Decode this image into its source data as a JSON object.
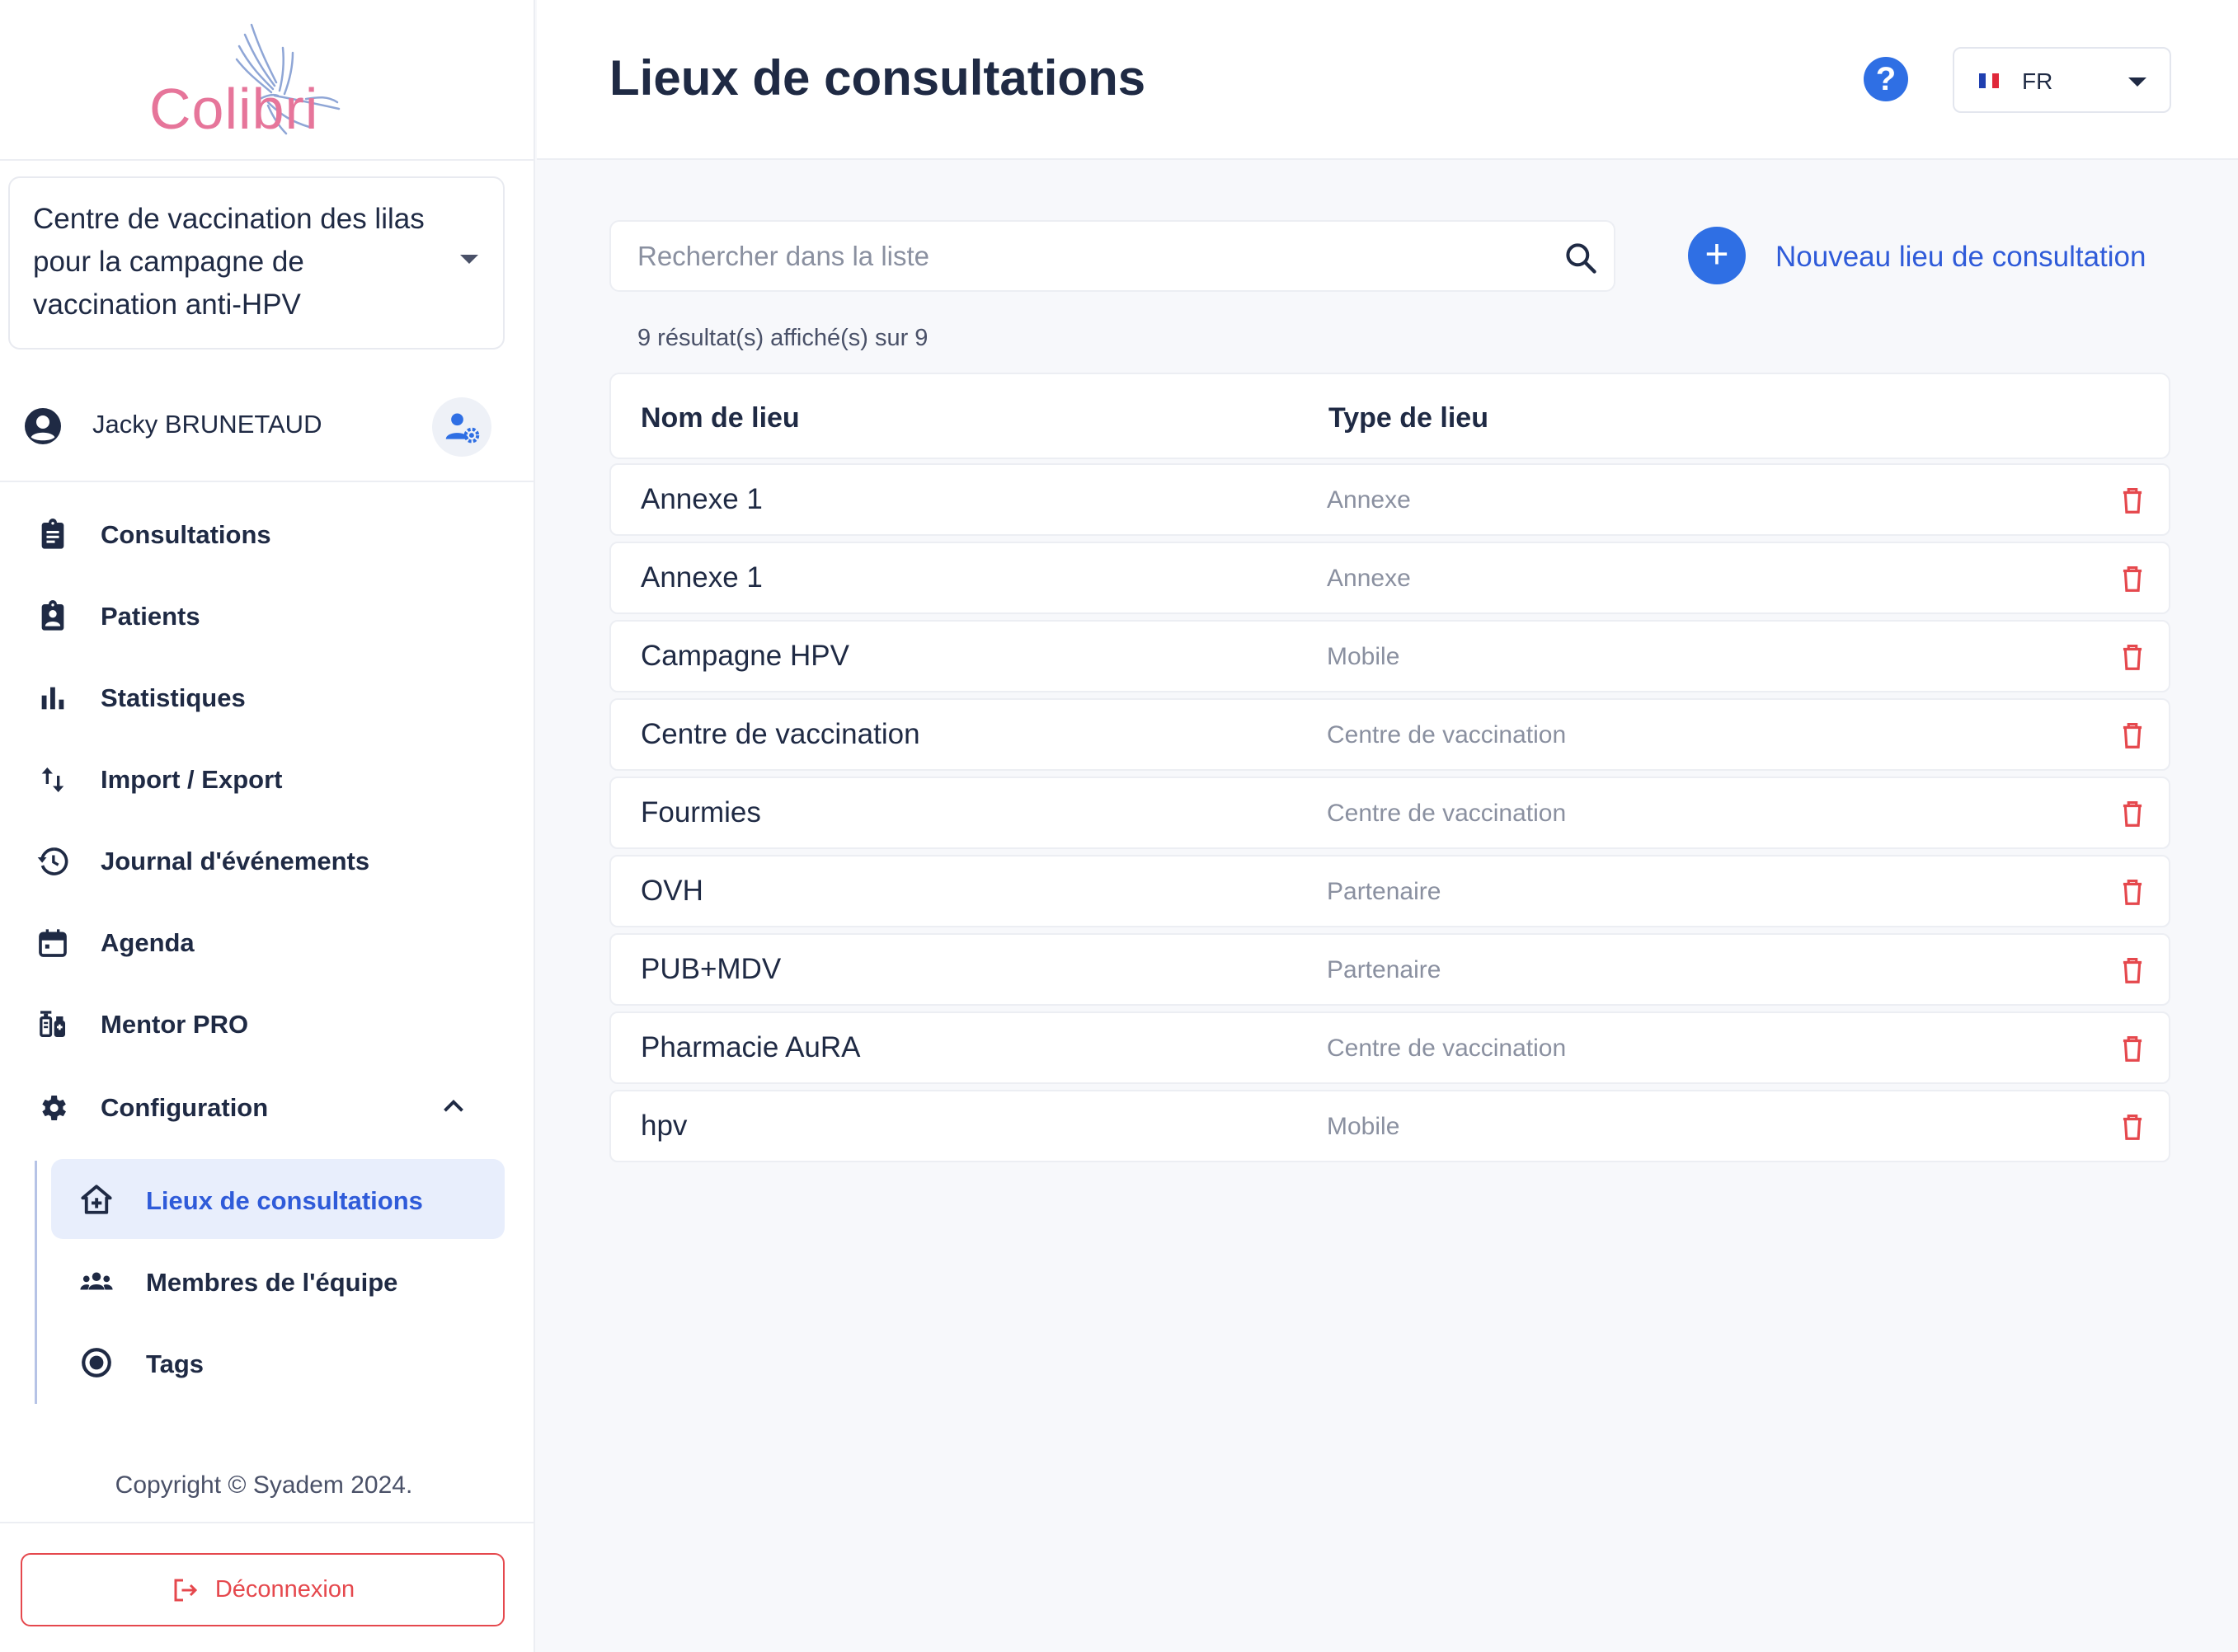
{
  "app": {
    "logo_text": "Colibri",
    "brand_color": "#e6759a",
    "accent_color": "#2f6fe4"
  },
  "sidebar": {
    "org_selector": {
      "value": "Centre de vaccination des lilas pour la campagne de vaccination anti-HPV",
      "icon": "caret-down-icon"
    },
    "user": {
      "name": "Jacky BRUNETAUD",
      "avatar_icon": "account-circle-icon",
      "settings_icon": "user-gear-icon"
    },
    "nav": [
      {
        "label": "Consultations",
        "icon": "clipboard-icon"
      },
      {
        "label": "Patients",
        "icon": "patient-badge-icon"
      },
      {
        "label": "Statistiques",
        "icon": "bar-chart-icon"
      },
      {
        "label": "Import / Export",
        "icon": "swap-vertical-icon"
      },
      {
        "label": "Journal d'événements",
        "icon": "history-icon"
      },
      {
        "label": "Agenda",
        "icon": "calendar-icon"
      },
      {
        "label": "Mentor PRO",
        "icon": "vaccine-icon"
      },
      {
        "label": "Configuration",
        "icon": "gear-icon",
        "expanded": true
      }
    ],
    "sub_nav": [
      {
        "label": "Lieux de consultations",
        "icon": "home-plus-icon",
        "active": true
      },
      {
        "label": "Membres de l'équipe",
        "icon": "team-icon",
        "active": false
      },
      {
        "label": "Tags",
        "icon": "radio-target-icon",
        "active": false
      }
    ],
    "copyright": "Copyright © Syadem 2024.",
    "logout_label": "Déconnexion"
  },
  "header": {
    "title": "Lieux de consultations",
    "help_label": "?",
    "language": "FR"
  },
  "main": {
    "search": {
      "placeholder": "Rechercher dans la liste",
      "value": ""
    },
    "new_button_label": "Nouveau lieu de consultation",
    "result_count": "9 résultat(s) affiché(s) sur 9",
    "table": {
      "columns": [
        "Nom de lieu",
        "Type de lieu"
      ],
      "rows": [
        {
          "name": "Annexe 1",
          "type": "Annexe"
        },
        {
          "name": "Annexe 1",
          "type": "Annexe"
        },
        {
          "name": "Campagne HPV",
          "type": "Mobile"
        },
        {
          "name": "Centre de vaccination",
          "type": "Centre de vaccination"
        },
        {
          "name": "Fourmies",
          "type": "Centre de vaccination"
        },
        {
          "name": "OVH",
          "type": "Partenaire"
        },
        {
          "name": "PUB+MDV",
          "type": "Partenaire"
        },
        {
          "name": "Pharmacie AuRA",
          "type": "Centre de vaccination"
        },
        {
          "name": "hpv",
          "type": "Mobile"
        }
      ]
    }
  }
}
